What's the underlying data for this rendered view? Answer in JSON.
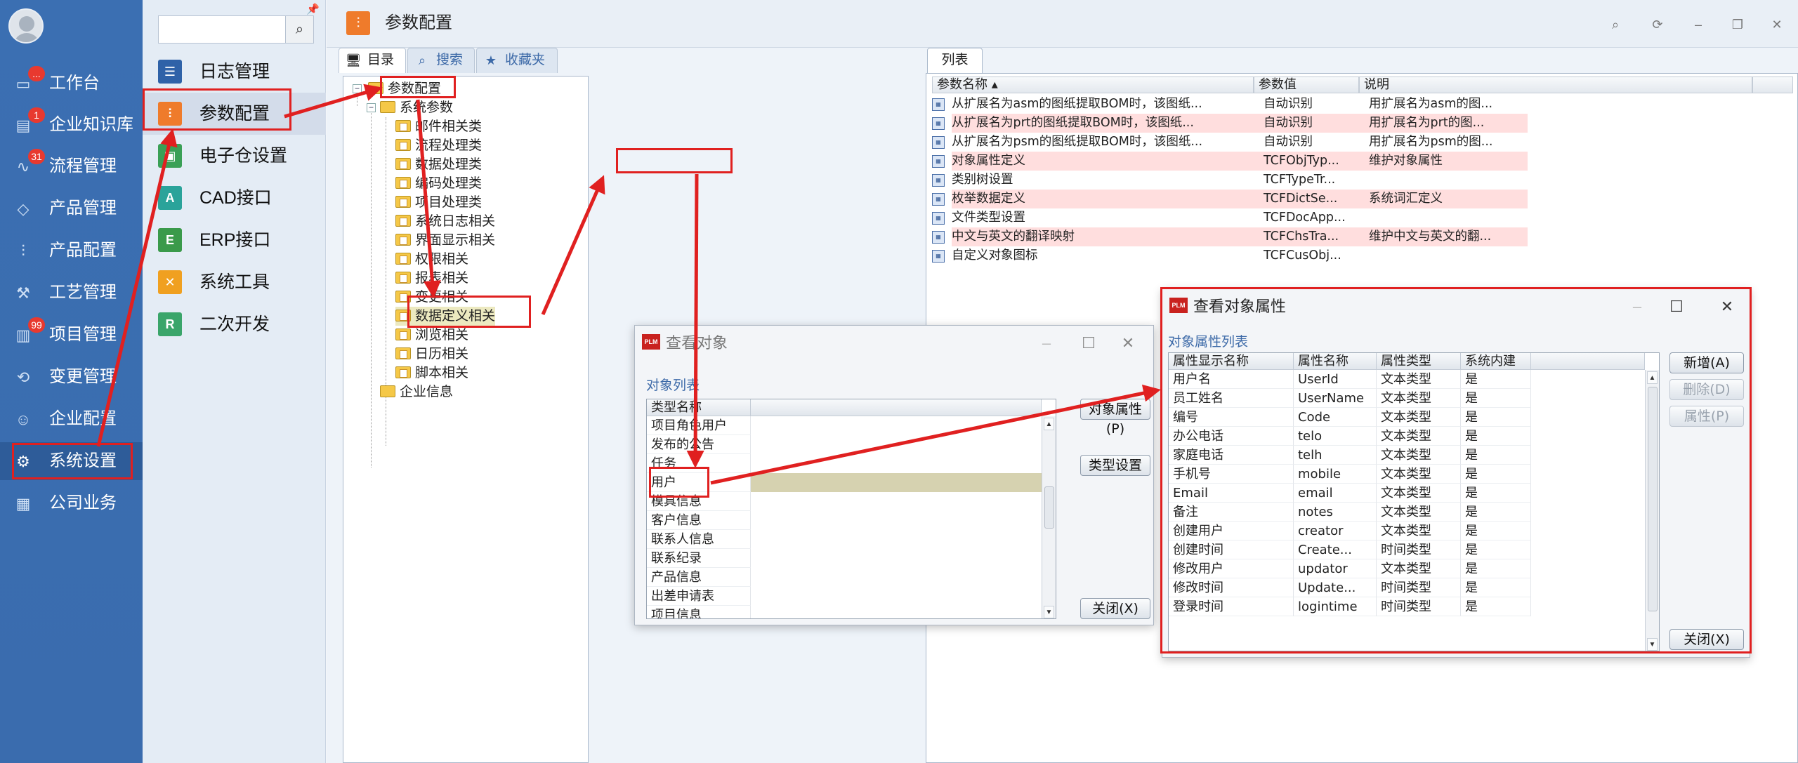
{
  "nav": {
    "items": [
      {
        "label": "工作台",
        "icon": "monitor-icon",
        "badge": "..."
      },
      {
        "label": "企业知识库",
        "icon": "book-icon",
        "badge": "1"
      },
      {
        "label": "流程管理",
        "icon": "flow-icon",
        "badge": "31"
      },
      {
        "label": "产品管理",
        "icon": "cube-icon",
        "badge": ""
      },
      {
        "label": "产品配置",
        "icon": "sliders-icon",
        "badge": ""
      },
      {
        "label": "工艺管理",
        "icon": "wrench-icon",
        "badge": ""
      },
      {
        "label": "项目管理",
        "icon": "chart-icon",
        "badge": "99"
      },
      {
        "label": "变更管理",
        "icon": "change-icon",
        "badge": ""
      },
      {
        "label": "企业配置",
        "icon": "people-icon",
        "badge": ""
      },
      {
        "label": "系统设置",
        "icon": "gear-icon",
        "badge": ""
      },
      {
        "label": "公司业务",
        "icon": "grid-icon",
        "badge": ""
      }
    ]
  },
  "submenu": {
    "search_placeholder": "",
    "items": [
      {
        "label": "日志管理",
        "icon": "log-icon",
        "color": "#2f62a8"
      },
      {
        "label": "参数配置",
        "icon": "sliders-icon",
        "color": "#ef7b2b"
      },
      {
        "label": "电子仓设置",
        "icon": "warehouse-icon",
        "color": "#3aa056"
      },
      {
        "label": "CAD接口",
        "icon": "cad-icon",
        "color": "#2aa39a"
      },
      {
        "label": "ERP接口",
        "icon": "erp-icon",
        "color": "#3a9a4a"
      },
      {
        "label": "系统工具",
        "icon": "tools-icon",
        "color": "#f0a020"
      },
      {
        "label": "二次开发",
        "icon": "dev-icon",
        "color": "#3aa56a"
      }
    ]
  },
  "main": {
    "title": "参数配置",
    "left_tabs": [
      "目录",
      "搜索",
      "收藏夹"
    ],
    "right_tab": "列表",
    "tree": {
      "root": "参数配置",
      "system_params": "系统参数",
      "children": [
        "邮件相关类",
        "流程处理类",
        "数据处理类",
        "编码处理类",
        "项目处理类",
        "系统日志相关",
        "界面显示相关",
        "权限相关",
        "报表相关",
        "变更相关",
        "数据定义相关",
        "浏览相关",
        "日历相关",
        "脚本相关"
      ],
      "enterprise": "企业信息"
    },
    "list": {
      "headers": [
        "参数名称",
        "参数值",
        "说明"
      ],
      "rows": [
        {
          "name": "从扩展名为asm的图纸提取BOM时，该图纸...",
          "value": "自动识别",
          "desc": "用扩展名为asm的图...",
          "pink": false
        },
        {
          "name": "从扩展名为prt的图纸提取BOM时，该图纸...",
          "value": "自动识别",
          "desc": "用扩展名为prt的图...",
          "pink": true
        },
        {
          "name": "从扩展名为psm的图纸提取BOM时，该图纸...",
          "value": "自动识别",
          "desc": "用扩展名为psm的图...",
          "pink": false
        },
        {
          "name": "对象属性定义",
          "value": "TCFObjTyp...",
          "desc": "维护对象属性",
          "pink": true
        },
        {
          "name": "类别树设置",
          "value": "TCFTypeTr...",
          "desc": "",
          "pink": false
        },
        {
          "name": "枚举数据定义",
          "value": "TCFDictSe...",
          "desc": "系统词汇定义",
          "pink": true
        },
        {
          "name": "文件类型设置",
          "value": "TCFDocApp...",
          "desc": "",
          "pink": false
        },
        {
          "name": "中文与英文的翻译映射",
          "value": "TCFChsTra...",
          "desc": "维护中文与英文的翻...",
          "pink": true
        },
        {
          "name": "自定义对象图标",
          "value": "TCFCusObj...",
          "desc": "",
          "pink": false
        }
      ]
    }
  },
  "dialog_objects": {
    "title": "查看对象",
    "list_label": "对象列表",
    "column": "类型名称",
    "items": [
      "项目角色用户",
      "发布的公告",
      "任务",
      "用户",
      "模具信息",
      "客户信息",
      "联系人信息",
      "联系纪录",
      "产品信息",
      "出差申请表",
      "项目信息"
    ],
    "selected": "用户",
    "buttons": {
      "attr": "对象属性(P)",
      "type": "类型设置",
      "close": "关闭(X)"
    }
  },
  "dialog_attrs": {
    "title": "查看对象属性",
    "list_label": "对象属性列表",
    "headers": [
      "属性显示名称",
      "属性名称",
      "属性类型",
      "系统内建"
    ],
    "rows": [
      [
        "用户名",
        "UserId",
        "文本类型",
        "是"
      ],
      [
        "员工姓名",
        "UserName",
        "文本类型",
        "是"
      ],
      [
        "编号",
        "Code",
        "文本类型",
        "是"
      ],
      [
        "办公电话",
        "telo",
        "文本类型",
        "是"
      ],
      [
        "家庭电话",
        "telh",
        "文本类型",
        "是"
      ],
      [
        "手机号",
        "mobile",
        "文本类型",
        "是"
      ],
      [
        "Email",
        "email",
        "文本类型",
        "是"
      ],
      [
        "备注",
        "notes",
        "文本类型",
        "是"
      ],
      [
        "创建用户",
        "creator",
        "文本类型",
        "是"
      ],
      [
        "创建时间",
        "Create...",
        "时间类型",
        "是"
      ],
      [
        "修改用户",
        "updator",
        "文本类型",
        "是"
      ],
      [
        "修改时间",
        "Update...",
        "时间类型",
        "是"
      ],
      [
        "登录时间",
        "logintime",
        "时间类型",
        "是"
      ]
    ],
    "buttons": {
      "add": "新增(A)",
      "delete": "删除(D)",
      "attr": "属性(P)",
      "close": "关闭(X)"
    }
  },
  "colors": {
    "nav_bg": "#3a6cae",
    "highlight": "#e02020",
    "pink_row": "#ffdede"
  }
}
